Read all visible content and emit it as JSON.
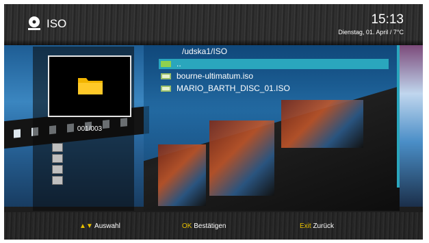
{
  "header": {
    "title": "ISO",
    "clock": "15:13",
    "date": "Dienstag, 01. April / 7°C",
    "icon": "disc-icon"
  },
  "preview": {
    "counter": "001/003",
    "icon": "folder-icon"
  },
  "list": {
    "path": "/udska1/ISO",
    "items": [
      {
        "label": "..",
        "icon": "folder-up-icon",
        "selected": true
      },
      {
        "label": "bourne-ultimatum.iso",
        "icon": "file-icon",
        "selected": false
      },
      {
        "label": "MARIO_BARTH_DISC_01.ISO",
        "icon": "file-icon",
        "selected": false
      }
    ]
  },
  "footer": {
    "nav_key": "▲▼",
    "nav_label": "Auswahl",
    "ok_key": "OK",
    "ok_label": "Bestätigen",
    "exit_key": "Exit",
    "exit_label": "Zurück"
  },
  "colors": {
    "selection": "#2aa6bd",
    "key_yellow": "#e8c000"
  }
}
